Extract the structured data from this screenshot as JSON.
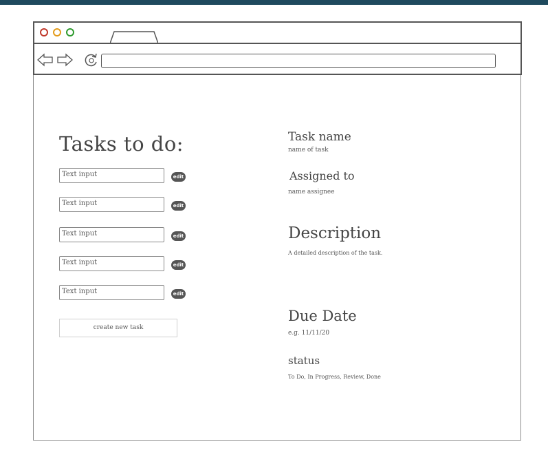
{
  "tasks": {
    "title": "Tasks to do:",
    "inputs": [
      {
        "placeholder": "Text input",
        "edit_label": "edit"
      },
      {
        "placeholder": "Text input",
        "edit_label": "edit"
      },
      {
        "placeholder": "Text input",
        "edit_label": "edit"
      },
      {
        "placeholder": "Text input",
        "edit_label": "edit"
      },
      {
        "placeholder": "Text input",
        "edit_label": "edit"
      }
    ],
    "create_label": "create new task"
  },
  "details": {
    "task_name_label": "Task name",
    "task_name_hint": "name of task",
    "assigned_label": "Assigned to",
    "assigned_hint": "name assignee",
    "description_label": "Description",
    "description_hint": "A detailed description of the task.",
    "due_label": "Due Date",
    "due_hint": "e.g. 11/11/20",
    "status_label": "status",
    "status_hint": "To Do, In Progress, Review, Done"
  },
  "browser": {
    "icons": [
      "back-arrow-icon",
      "forward-arrow-icon",
      "reload-icon"
    ],
    "dot_colors": [
      "#c0392b",
      "#e39b1a",
      "#2e9a2e"
    ]
  }
}
